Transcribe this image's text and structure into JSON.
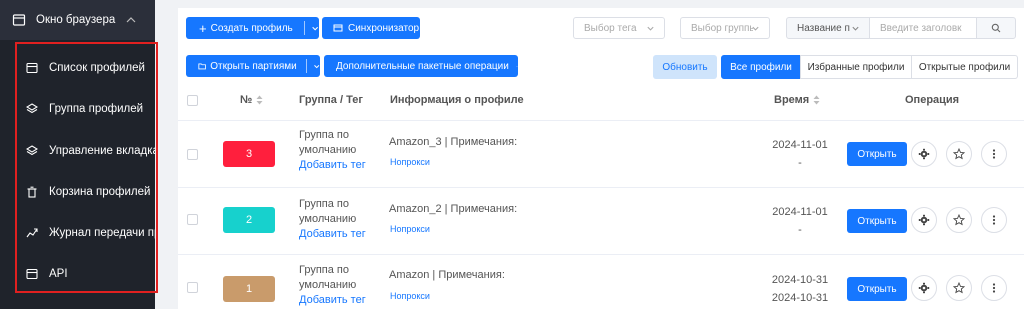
{
  "sidebar": {
    "header": "Окно браузера",
    "items": [
      {
        "label": "Список профилей",
        "icon": "window-icon"
      },
      {
        "label": "Группа профилей",
        "icon": "layers-icon"
      },
      {
        "label": "Управление вкладками",
        "icon": "layers-icon"
      },
      {
        "label": "Корзина профилей",
        "icon": "trash-icon"
      },
      {
        "label": "Журнал передачи профилей",
        "icon": "transfer-icon"
      },
      {
        "label": "API",
        "icon": "window-icon"
      }
    ]
  },
  "toolbar": {
    "create_profile": "Создать профиль",
    "synchronizer": "Синхронизатор",
    "tag_placeholder": "Выбор тега",
    "group_placeholder": "Выбор группы",
    "name_filter": "Название п",
    "search_placeholder": "Введите заголовк",
    "open_batch": "Открыть партиями",
    "batch_ops": "Дополнительные пакетные операции",
    "refresh": "Обновить",
    "segments": [
      "Все профили",
      "Избранные профили",
      "Открытые профили"
    ]
  },
  "table": {
    "headers": {
      "num": "№",
      "group": "Группа / Тег",
      "info": "Информация о профиле",
      "time": "Время",
      "operation": "Операция"
    },
    "rows": [
      {
        "num": "3",
        "color": "#ff1f3d",
        "group": [
          "Группа по",
          "умолчанию"
        ],
        "add_tag": "Добавить тег",
        "info": "Amazon_3 | Примечания:",
        "proxy": "Нопрокси",
        "time": [
          "2024-11-01",
          "-"
        ],
        "open": "Открыть"
      },
      {
        "num": "2",
        "color": "#17d1cd",
        "group": [
          "Группа по",
          "умолчанию"
        ],
        "add_tag": "Добавить тег",
        "info": "Amazon_2 | Примечания:",
        "proxy": "Нопрокси",
        "time": [
          "2024-11-01",
          "-"
        ],
        "open": "Открыть"
      },
      {
        "num": "1",
        "color": "#c99b6b",
        "group": [
          "Группа по",
          "умолчанию"
        ],
        "add_tag": "Добавить тег",
        "info": "Amazon | Примечания:",
        "proxy": "Нопрокси",
        "time": [
          "2024-10-31",
          "2024-10-31"
        ],
        "open": "Открыть"
      }
    ]
  }
}
